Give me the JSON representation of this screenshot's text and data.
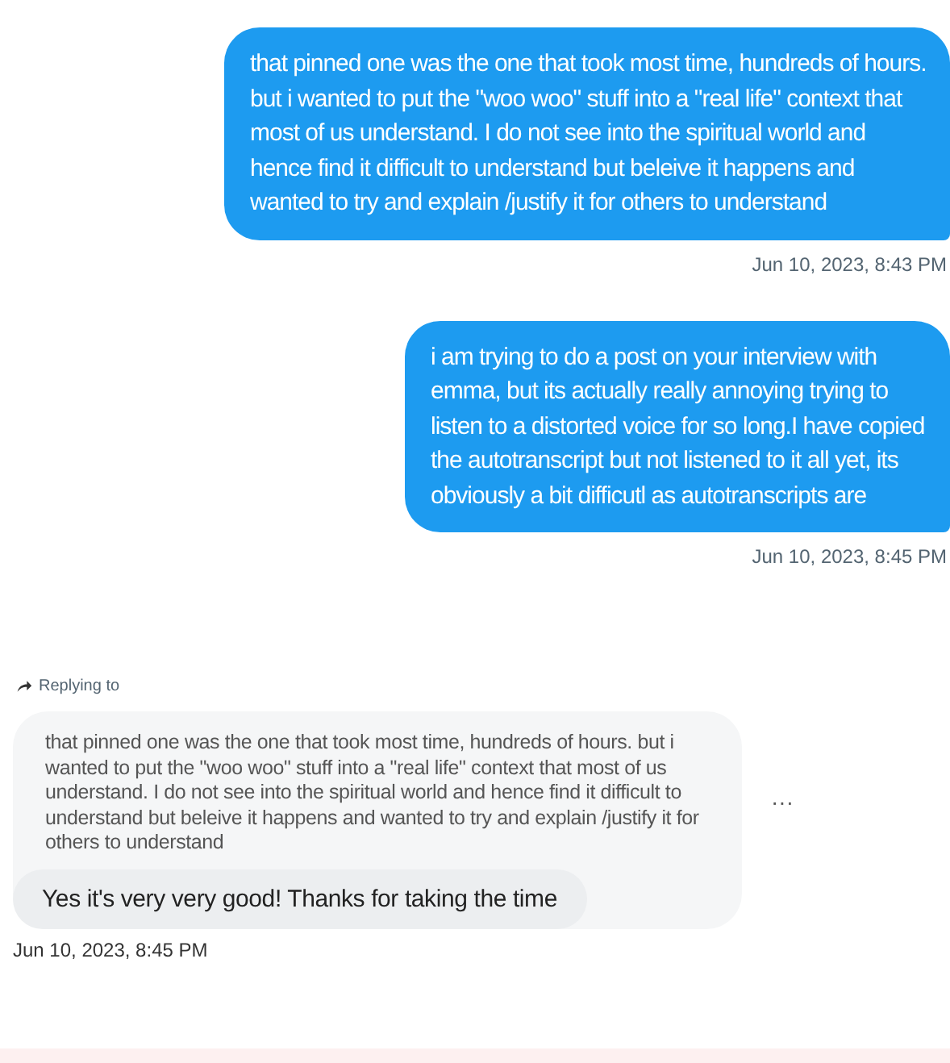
{
  "messages": [
    {
      "kind": "sent",
      "text": "that pinned one was the one that took most time, hundreds of hours. but i wanted to put the \"woo woo\" stuff into a \"real life\" context that most of us understand. I do not see into the spiritual world and hence find it difficult to understand but beleive it happens and wanted to try and explain /justify it for others to understand",
      "time": "Jun 10, 2023, 8:43 PM"
    },
    {
      "kind": "sent",
      "text": "i am trying to do a post on your interview with emma, but its actually really annoying trying to listen to a distorted voice  for so long.I have copied the autotranscript but not listened to it all yet, its obviously a bit difficutl as autotranscripts are",
      "time": "Jun 10, 2023, 8:45 PM"
    },
    {
      "kind": "received",
      "replying_label": "Replying to",
      "quoted": "that pinned one was the one that took most time, hundreds of hours. but i wanted to put the \"woo woo\" stuff into a \"real life\" context that most of us understand.  I do not see into the spiritual world and hence find it difficult to understand but beleive it happens and wanted to try and explain /justify it for others to understand",
      "text": "Yes it's very very good! Thanks for taking the time",
      "more": "···",
      "time": "Jun 10, 2023, 8:45 PM"
    }
  ]
}
